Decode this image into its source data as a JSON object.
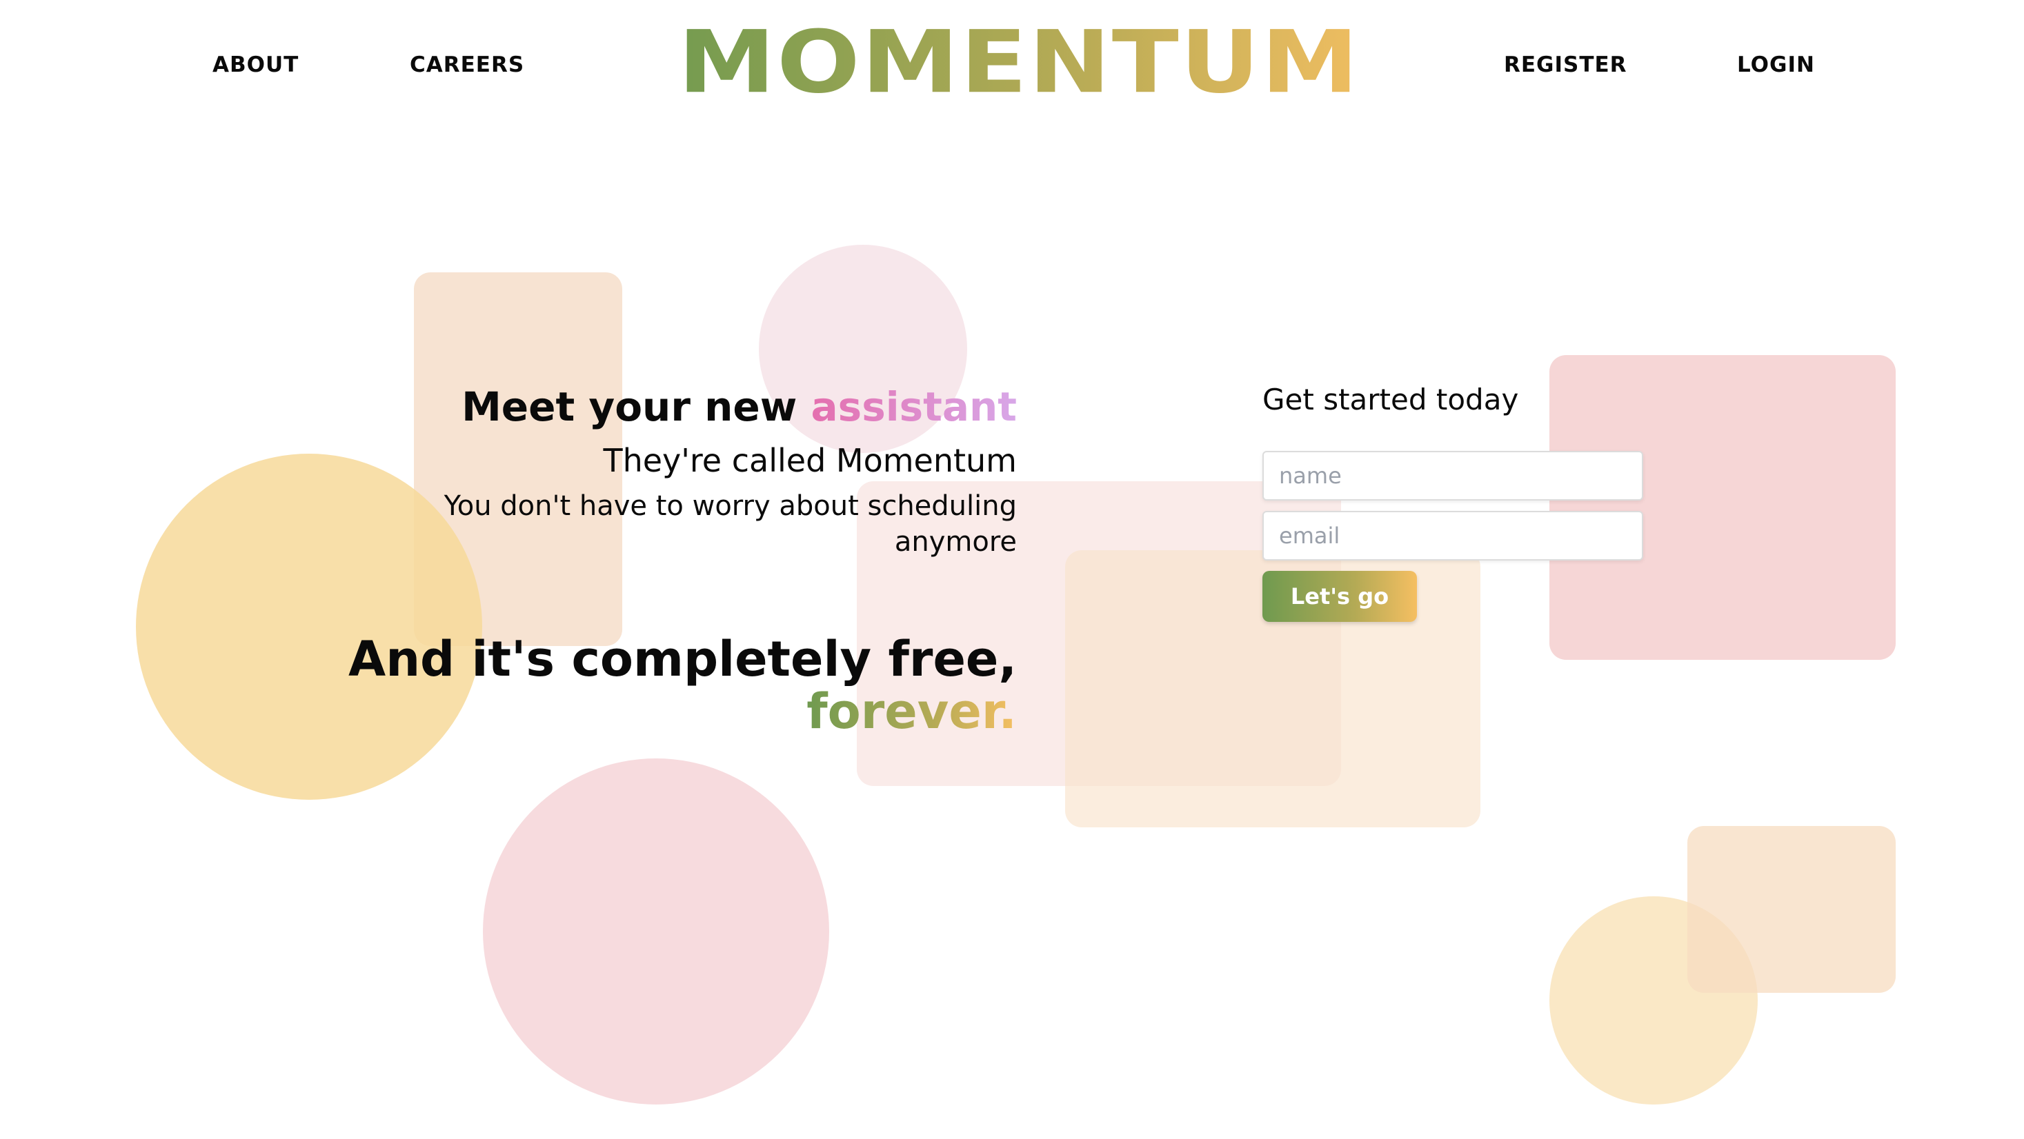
{
  "header": {
    "nav_left": [
      {
        "label": "ABOUT"
      },
      {
        "label": "CAREERS"
      }
    ],
    "logo_text": "MOMENTUM",
    "nav_right": [
      {
        "label": "REGISTER"
      },
      {
        "label": "LOGIN"
      }
    ]
  },
  "hero": {
    "title_prefix": "Meet your new ",
    "title_accent": "assistant",
    "subtitle": "They're called Momentum",
    "description": "You don't have to worry about scheduling anymore",
    "free_line": "And it's completely free,",
    "forever_line": "forever."
  },
  "signup": {
    "heading": "Get started today",
    "name_placeholder": "name",
    "email_placeholder": "email",
    "submit_label": "Let's go"
  },
  "colors": {
    "brand_green": "#6f9a4f",
    "brand_gold": "#f5bf62",
    "accent_pink": "#e46fae",
    "accent_lavender": "#d8a7e8"
  }
}
